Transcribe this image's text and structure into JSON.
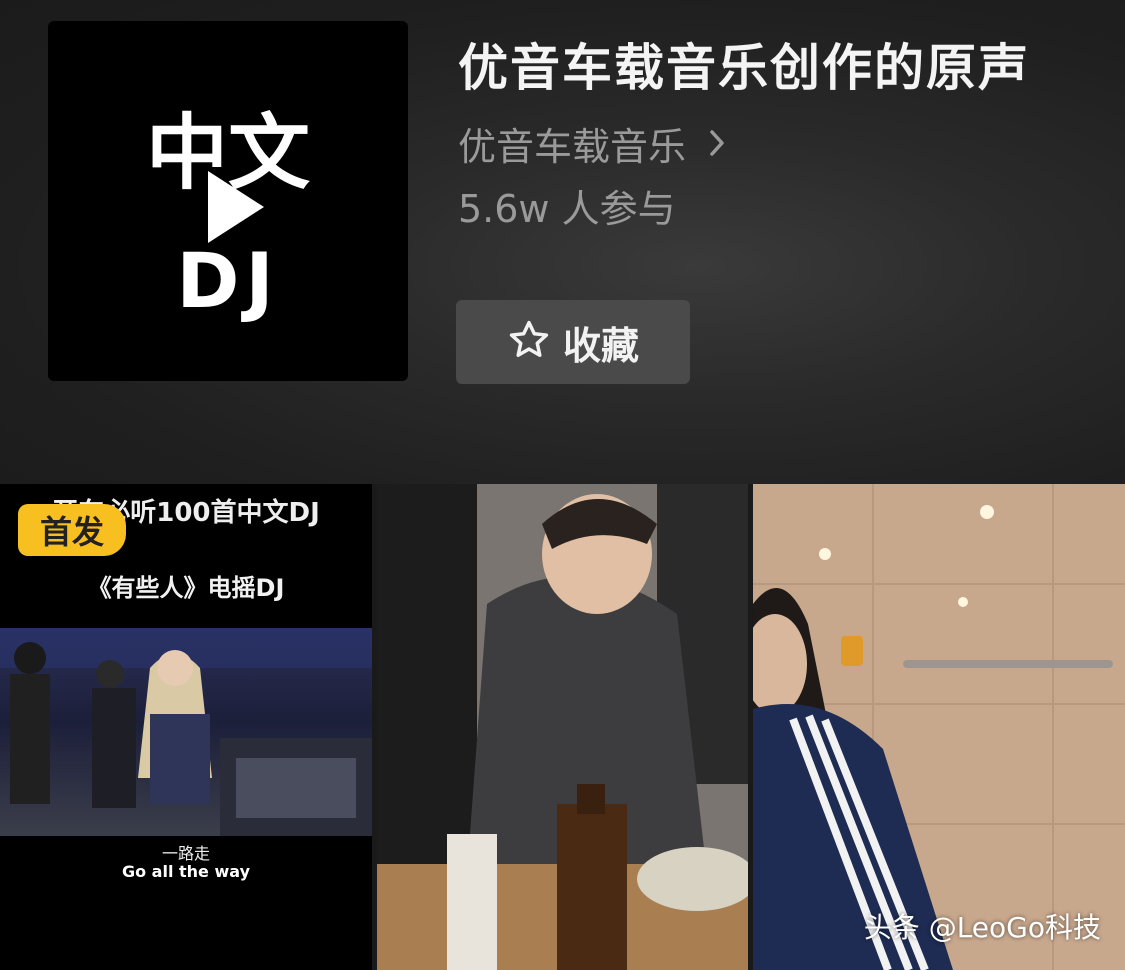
{
  "sound": {
    "cover": {
      "line1": "中文",
      "line2": "DJ"
    },
    "title": "优音车载音乐创作的原声",
    "artist": "优音车载音乐",
    "participants": "5.6w 人参与",
    "favorite_label": "收藏"
  },
  "videos": [
    {
      "top_text": "开车必听100首中文DJ",
      "badge": "首发",
      "subtitle": "《有些人》电摇DJ",
      "lyric_line1": "一路走",
      "lyric_line2": "Go all the way"
    },
    {},
    {}
  ],
  "watermark": "头条 @LeoGo科技",
  "colors": {
    "badge": "#f7c020",
    "button_bg": "#4a4a4a",
    "secondary_text": "#9a9a9a"
  }
}
